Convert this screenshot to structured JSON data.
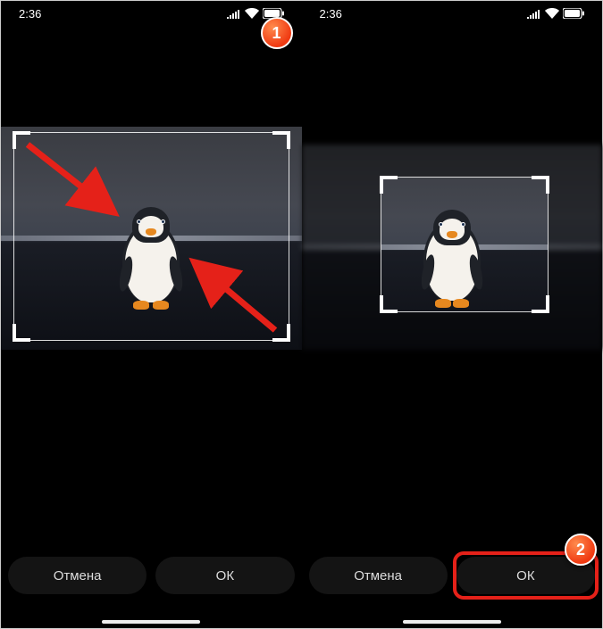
{
  "status": {
    "time": "2:36"
  },
  "screens": {
    "left": {
      "buttons": {
        "cancel": "Отмена",
        "ok": "ОК"
      },
      "badge": "1"
    },
    "right": {
      "buttons": {
        "cancel": "Отмена",
        "ok": "ОК"
      },
      "badge": "2"
    }
  }
}
